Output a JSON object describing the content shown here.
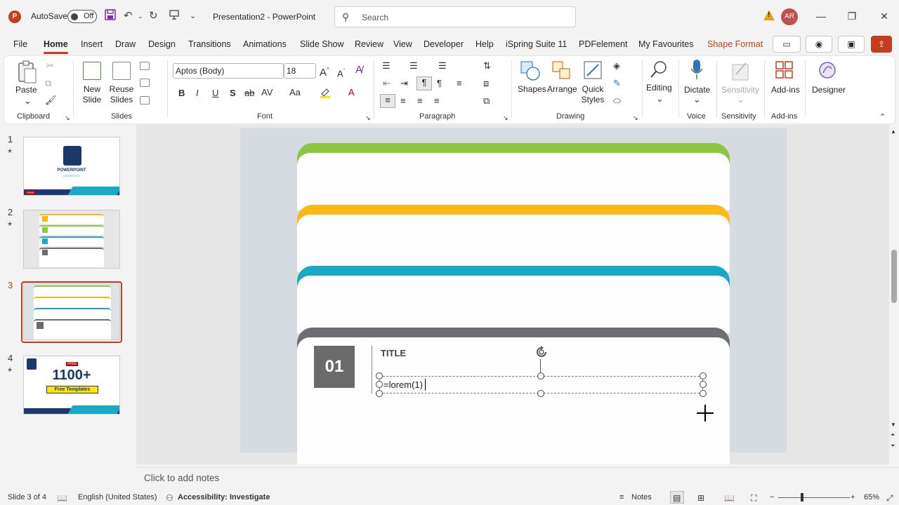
{
  "titlebar": {
    "app_logo": "P",
    "autosave_label": "AutoSave",
    "autosave_state": "Off",
    "doc_title": "Presentation2  -  PowerPoint",
    "search_placeholder": "Search",
    "avatar_initials": "AR",
    "quick_access_icons": [
      "save-icon",
      "undo-icon",
      "redo-icon",
      "present-icon",
      "customize-icon"
    ],
    "window_buttons": [
      "—",
      "❐",
      "✕"
    ]
  },
  "menu": {
    "items": [
      "File",
      "Home",
      "Insert",
      "Draw",
      "Design",
      "Transitions",
      "Animations",
      "Slide Show",
      "Review",
      "View",
      "Developer",
      "Help",
      "iSpring Suite 11",
      "PDFelement",
      "My Favourites",
      "Shape Format"
    ],
    "active": "Home"
  },
  "ribbon": {
    "clipboard": {
      "paste_label": "Paste",
      "group_label": "Clipboard"
    },
    "slides": {
      "new_slide_label": "New Slide",
      "reuse_slides_label": "Reuse Slides",
      "group_label": "Slides"
    },
    "font": {
      "font_name": "Aptos (Body)",
      "font_size": "18",
      "bold": "B",
      "italic": "I",
      "underline": "U",
      "strike": "ab",
      "spacing": "AV",
      "case": "Aa",
      "group_label": "Font"
    },
    "paragraph": {
      "group_label": "Paragraph"
    },
    "drawing": {
      "shapes_label": "Shapes",
      "arrange_label": "Arrange",
      "quick_styles_label": "Quick Styles",
      "group_label": "Drawing"
    },
    "editing": {
      "label": "Editing"
    },
    "voice": {
      "dictate_label": "Dictate",
      "group_label": "Voice"
    },
    "sensitivity": {
      "label": "Sensitivity",
      "group_label": "Sensitivity"
    },
    "addins": {
      "label": "Add-ins",
      "group_label": "Add-ins"
    },
    "designer": {
      "label": "Designer"
    }
  },
  "slides": [
    {
      "number": "1",
      "title_art": "POWERPOINT",
      "subtitle_art": "UNIVERSITY",
      "badge": "FREE"
    },
    {
      "number": "2"
    },
    {
      "number": "3",
      "current": true
    },
    {
      "number": "4",
      "badge": "FREE",
      "big_text": "1100+",
      "sub_text": "Free Templates"
    }
  ],
  "canvas": {
    "card_colors": [
      "#8dc63f",
      "#fdb913",
      "#17a9c6",
      "#6d6e71"
    ],
    "item_number": "01",
    "item_title": "TITLE",
    "editing_text": "=lorem(1)"
  },
  "notes_placeholder": "Click to add notes",
  "statusbar": {
    "slide_info": "Slide 3 of 4",
    "language": "English (United States)",
    "accessibility": "Accessibility: Investigate",
    "notes_label": "Notes",
    "zoom": "65%"
  }
}
